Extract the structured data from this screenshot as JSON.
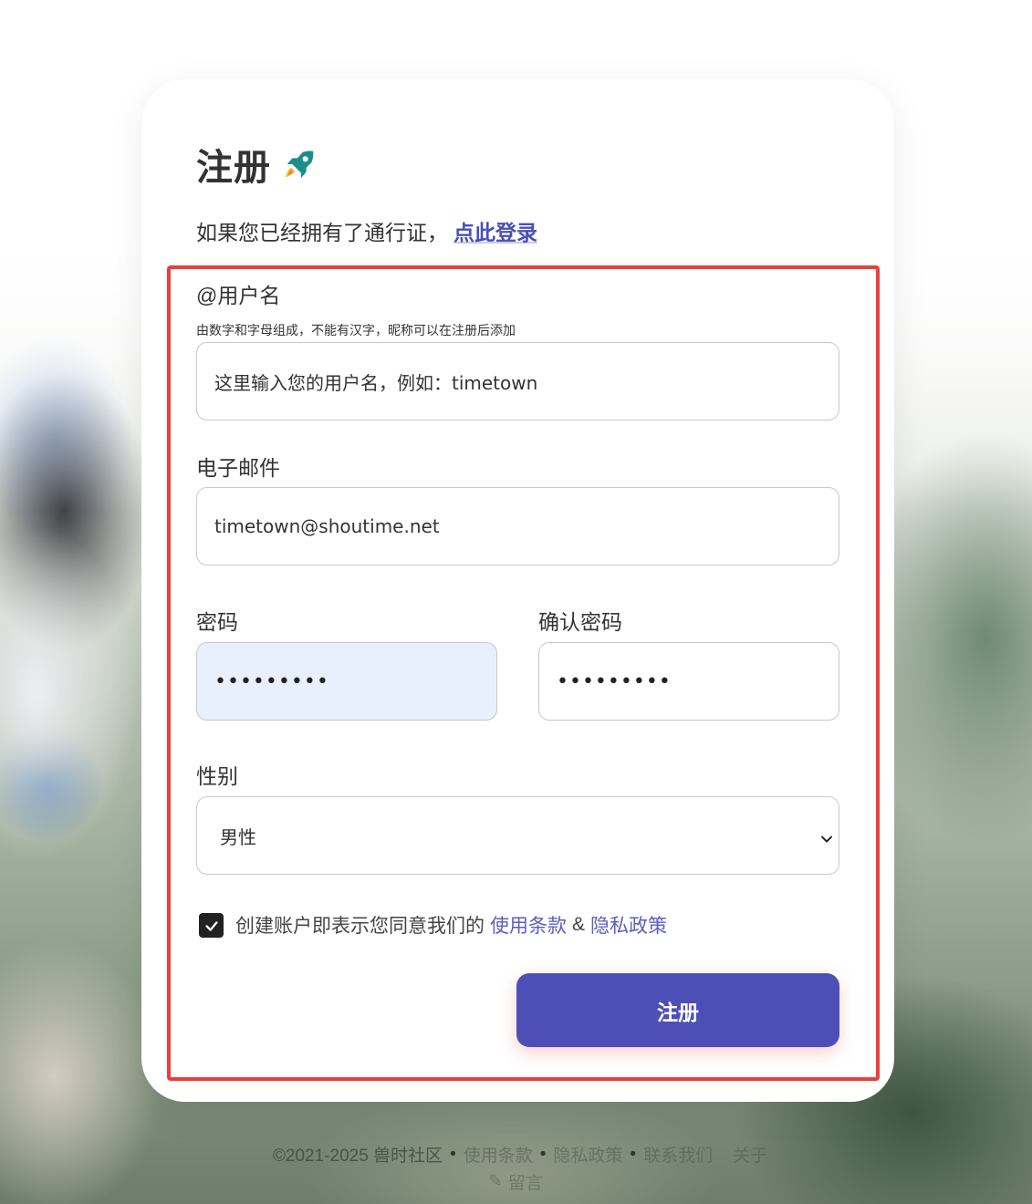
{
  "page": {
    "title": "注册",
    "title_icon": "rocket-icon",
    "login_prompt": "如果您已经拥有了通行证，",
    "login_link": "点此登录"
  },
  "form": {
    "username": {
      "label": "@用户名",
      "hint": "由数字和字母组成，不能有汉字，昵称可以在注册后添加",
      "placeholder": "这里输入您的用户名，例如：timetown"
    },
    "email": {
      "label": "电子邮件",
      "value": "timetown@shoutime.net"
    },
    "password": {
      "label": "密码",
      "value": "•••••••••"
    },
    "confirm_password": {
      "label": "确认密码",
      "value": "•••••••••"
    },
    "gender": {
      "label": "性别",
      "selected": "男性"
    },
    "agreement": {
      "checked": true,
      "text": "创建账户即表示您同意我们的",
      "terms_link": "使用条款",
      "amp": "&",
      "privacy_link": "隐私政策"
    },
    "submit_label": "注册"
  },
  "footer": {
    "copyright": "©2021-2025 兽时社区",
    "links": [
      "使用条款",
      "隐私政策",
      "联系我们",
      "关于"
    ],
    "second_line": "留言"
  },
  "colors": {
    "accent": "#4e4fb6",
    "link": "#4a4fb3",
    "highlight_border": "#e8403f",
    "autofill_bg": "#e8f0fd"
  }
}
